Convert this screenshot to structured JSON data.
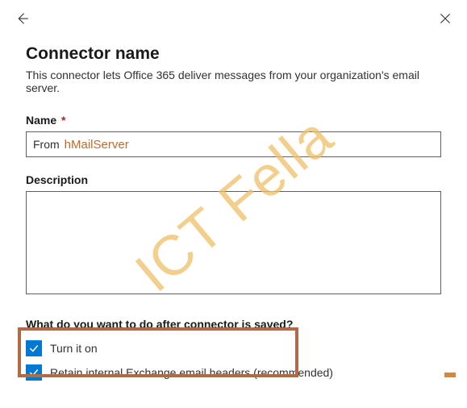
{
  "header": {
    "title": "Connector name",
    "subtitle": "This connector lets Office 365 deliver messages from your organization's email server."
  },
  "name_field": {
    "label": "Name",
    "required_mark": "*",
    "prefix": "From",
    "value": "hMailServer"
  },
  "description_field": {
    "label": "Description",
    "value": ""
  },
  "after_save": {
    "heading": "What do you want to do after connector is saved?",
    "options": [
      {
        "label": "Turn it on",
        "checked": true
      },
      {
        "label": "Retain internal Exchange email headers (recommended)",
        "checked": true
      }
    ]
  },
  "watermark": "ICT Fella"
}
